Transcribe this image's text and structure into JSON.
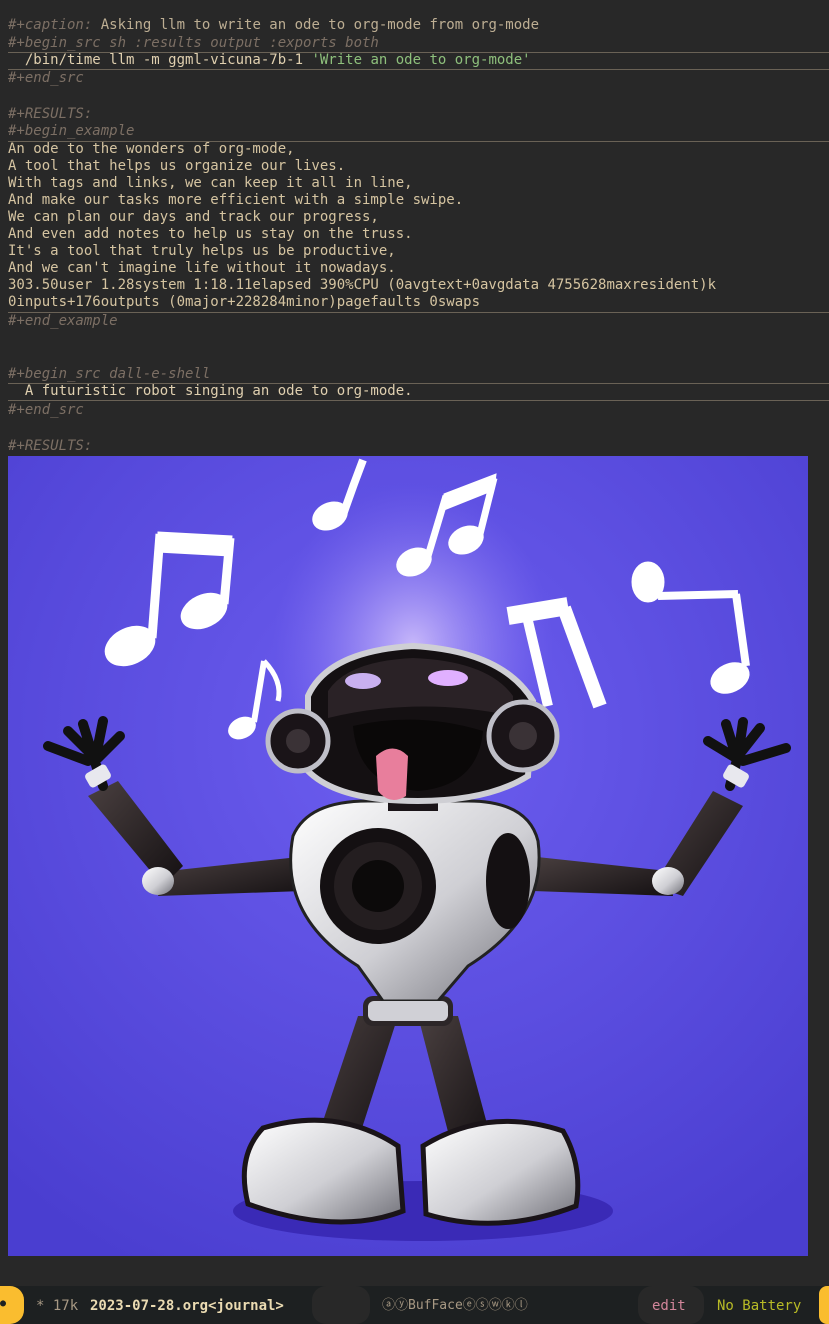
{
  "caption": {
    "keyword": "#+caption:",
    "text": " Asking llm to write an ode to org-mode from org-mode"
  },
  "src_block_1": {
    "begin": "#+begin_src sh :results output :exports both",
    "command_prefix": "  /bin/time llm -m ggml-vicuna-7b-1 ",
    "command_string": "'Write an ode to org-mode'",
    "end": "#+end_src"
  },
  "results_1": {
    "keyword": "#+RESULTS:",
    "begin": "#+begin_example",
    "lines": [
      "An ode to the wonders of org-mode,",
      "A tool that helps us organize our lives.",
      "With tags and links, we can keep it all in line,",
      "And make our tasks more efficient with a simple swipe.",
      "We can plan our days and track our progress,",
      "And even add notes to help us stay on the truss.",
      "It's a tool that truly helps us be productive,",
      "And we can't imagine life without it nowadays.",
      "303.50user 1.28system 1:18.11elapsed 390%CPU (0avgtext+0avgdata 4755628maxresident)k",
      "0inputs+176outputs (0major+228284minor)pagefaults 0swaps"
    ],
    "end": "#+end_example"
  },
  "src_block_2": {
    "begin": "#+begin_src dall-e-shell",
    "prompt": "  A futuristic robot singing an ode to org-mode.",
    "end": "#+end_src"
  },
  "results_2": {
    "keyword": "#+RESULTS:"
  },
  "modeline": {
    "modified": "* 17k ",
    "buffer_name": "2023-07-28.org<journal>",
    "minor_modes": "ⓐⓨBufFaceⓔⓢⓦⓚⓛ",
    "state": "edit",
    "battery": "No Battery"
  },
  "colors": {
    "background": "#282828",
    "keyword": "#7c6f64",
    "string": "#8ec07c",
    "image_background": "#5548d8",
    "modeline_accent": "#fabd2f"
  }
}
